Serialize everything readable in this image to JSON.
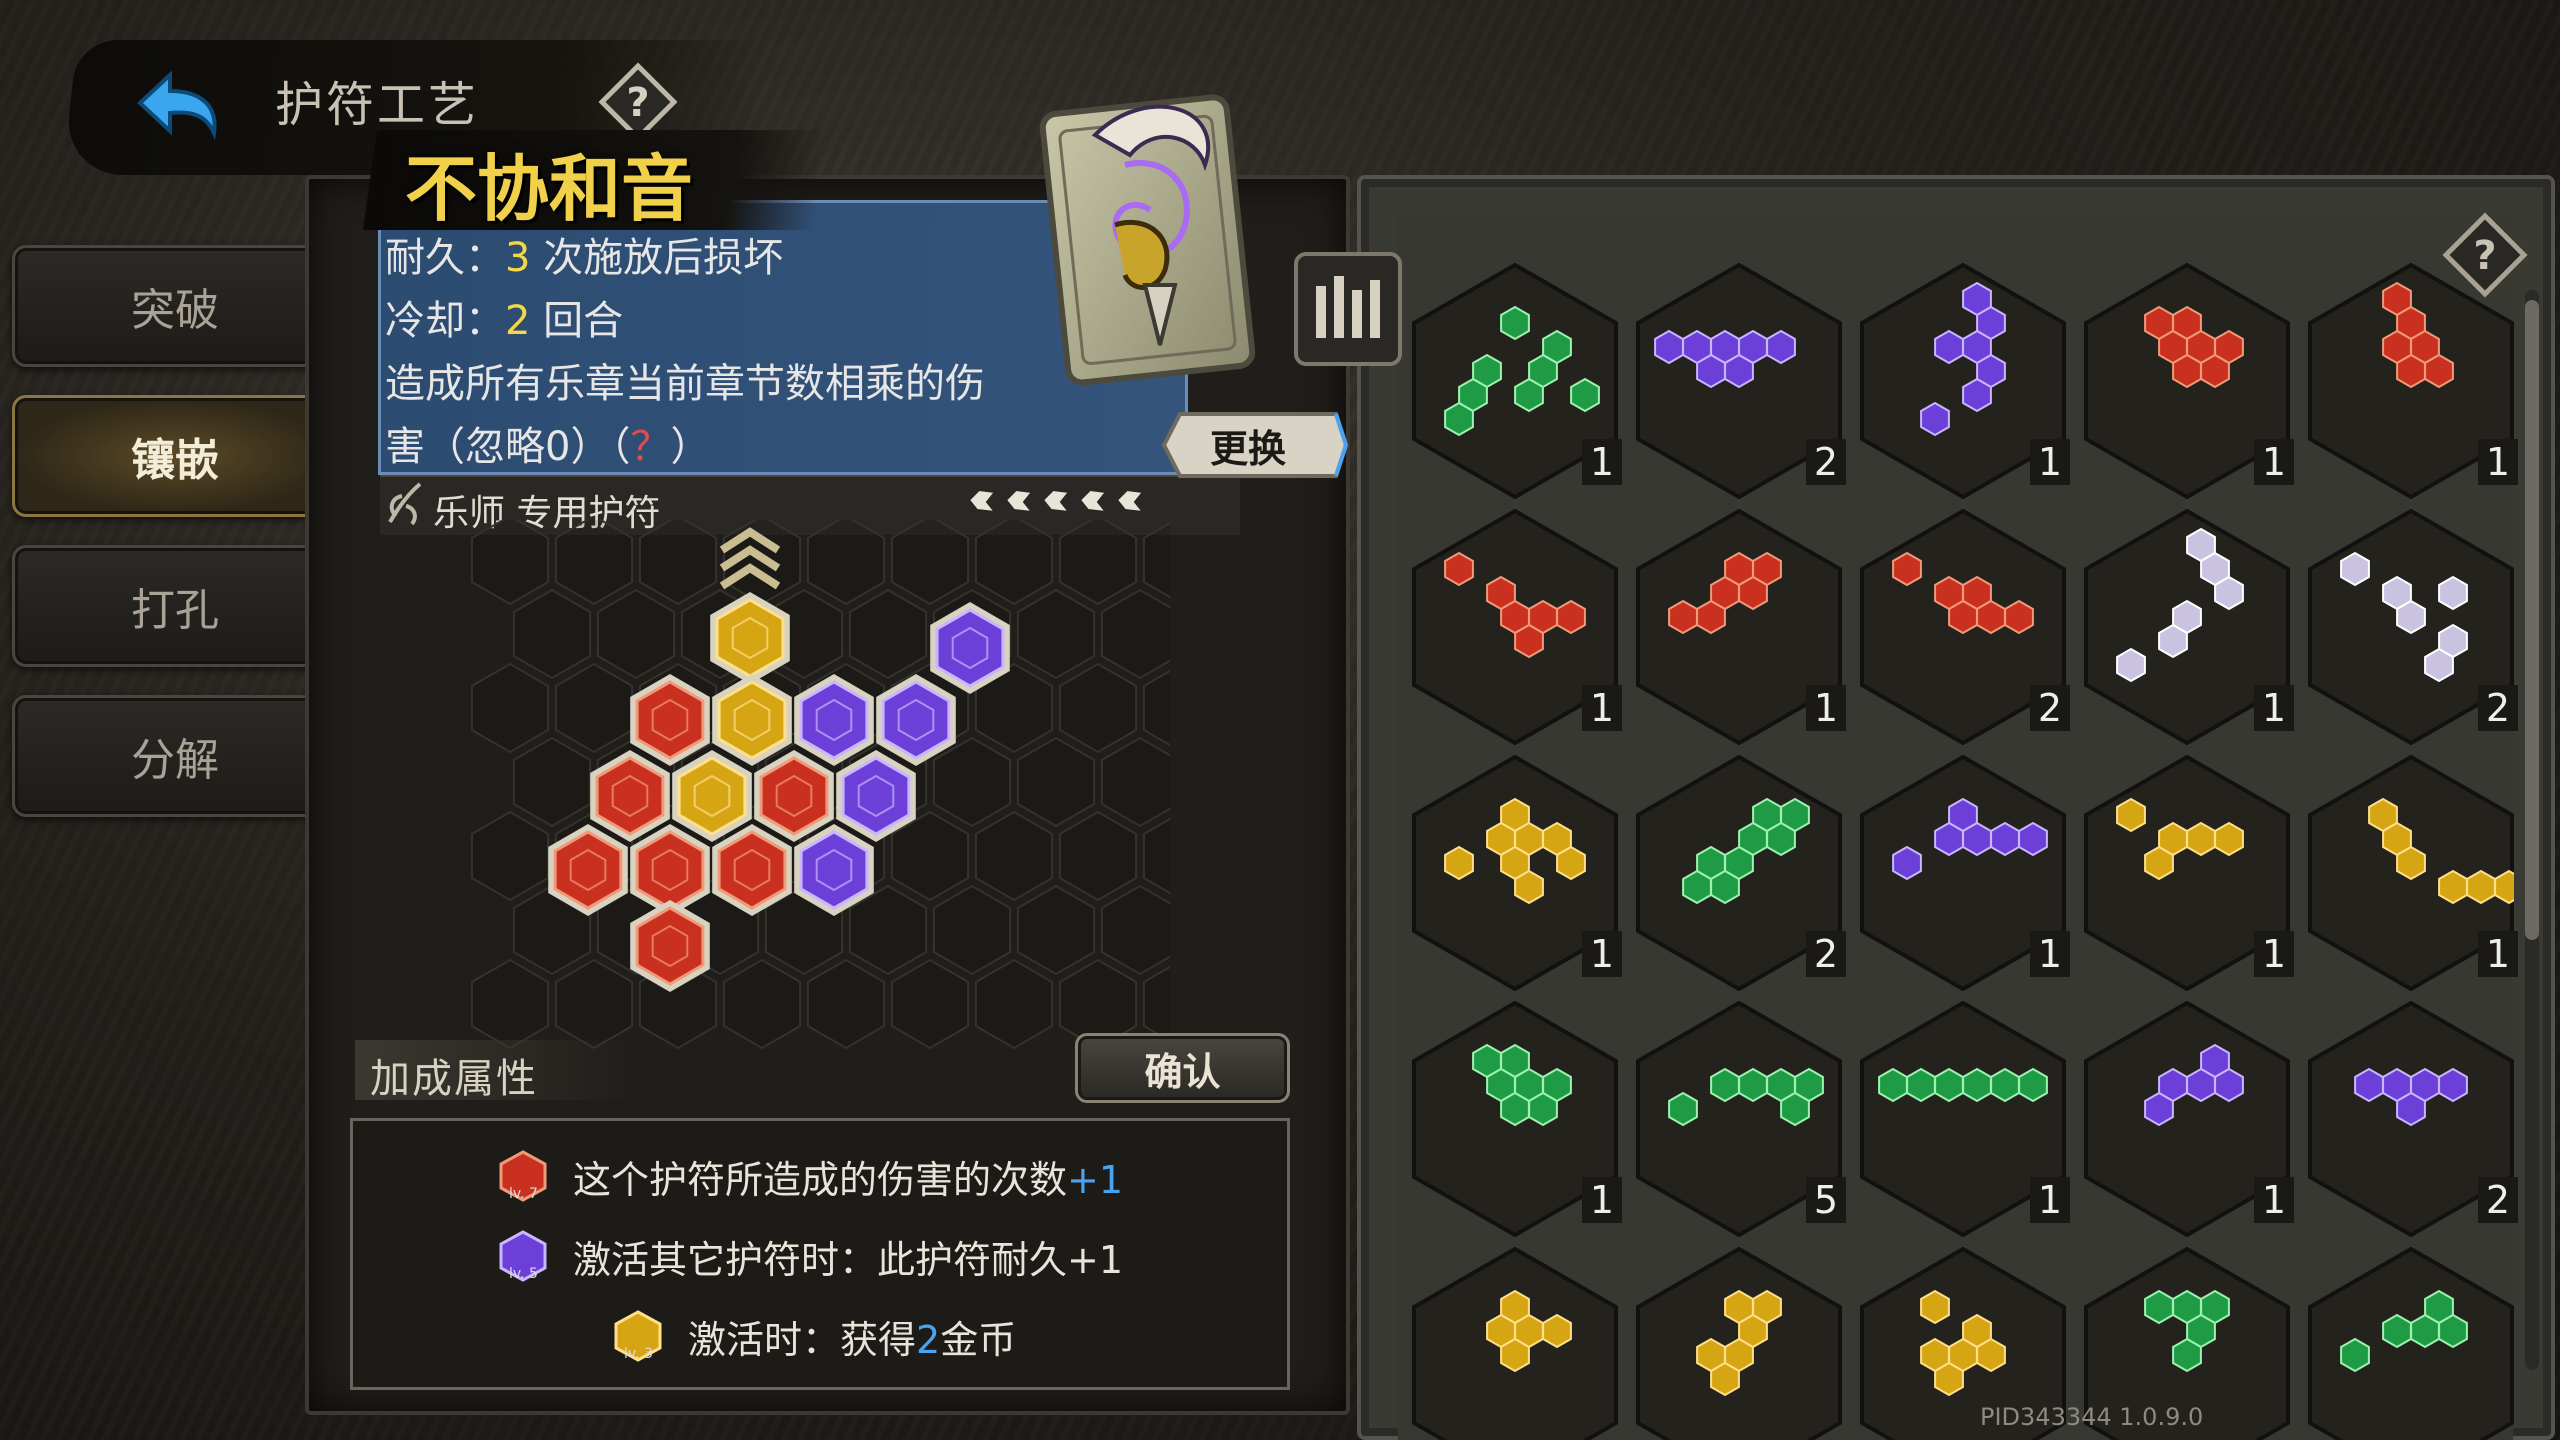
{
  "header": {
    "title": "护符工艺"
  },
  "menu": [
    {
      "label": "突破",
      "active": false
    },
    {
      "label": "镶嵌",
      "active": true
    },
    {
      "label": "打孔",
      "active": false
    },
    {
      "label": "分解",
      "active": false
    }
  ],
  "charm": {
    "name": "不协和音",
    "durability": {
      "label": "耐久：",
      "value": "3",
      "suffix": " 次施放后损坏"
    },
    "cooldown": {
      "label": "冷却：",
      "value": "2",
      "suffix": " 回合"
    },
    "desc_line1": "造成所有乐章当前章节数相乘的伤",
    "desc_line2_pre": "害（忽略0）（",
    "desc_line2_q": "？",
    "desc_line2_post": "）",
    "exclusive": "乐师 专用护符",
    "stars_filled": 5,
    "stars_total": 5,
    "replace_label": "更换"
  },
  "bonus": {
    "title": "加成属性",
    "confirm_label": "确认",
    "rows": [
      {
        "gem": "red",
        "level": "lv. 7",
        "text": "这个护符所造成的伤害的次数",
        "highlight": "+1"
      },
      {
        "gem": "purple",
        "level": "lv. 5",
        "text": "激活其它护符时：此护符耐久+1",
        "highlight": ""
      },
      {
        "gem": "yellow",
        "level": "lv. 3",
        "text_pre": "激活时：获得",
        "highlight": "2",
        "text_post": "金币"
      }
    ]
  },
  "inventory": [
    {
      "color": "green",
      "count": "1"
    },
    {
      "color": "purple",
      "count": "2"
    },
    {
      "color": "purple",
      "count": "1"
    },
    {
      "color": "red",
      "count": "1"
    },
    {
      "color": "red",
      "count": "1"
    },
    {
      "color": "red",
      "count": "1"
    },
    {
      "color": "red",
      "count": "1"
    },
    {
      "color": "red",
      "count": "2"
    },
    {
      "color": "white",
      "count": "1"
    },
    {
      "color": "white",
      "count": "2"
    },
    {
      "color": "yellow",
      "count": "1"
    },
    {
      "color": "green",
      "count": "2"
    },
    {
      "color": "purple",
      "count": "1"
    },
    {
      "color": "yellow",
      "count": "1"
    },
    {
      "color": "yellow",
      "count": "1"
    },
    {
      "color": "green",
      "count": "1"
    },
    {
      "color": "green",
      "count": "5"
    },
    {
      "color": "green",
      "count": "1"
    },
    {
      "color": "purple",
      "count": "1"
    },
    {
      "color": "purple",
      "count": "2"
    },
    {
      "color": "yellow",
      "count": ""
    },
    {
      "color": "yellow",
      "count": ""
    },
    {
      "color": "yellow",
      "count": ""
    },
    {
      "color": "green",
      "count": ""
    },
    {
      "color": "green",
      "count": ""
    }
  ],
  "colors": {
    "red": "#c9301f",
    "purple": "#6b3fd8",
    "yellow": "#d6a514",
    "green": "#1f9b45",
    "white": "#c9c2e0",
    "accent_yellow": "#f5d846",
    "accent_blue": "#4aa3f0"
  },
  "version": "PID343344  1.0.9.0"
}
